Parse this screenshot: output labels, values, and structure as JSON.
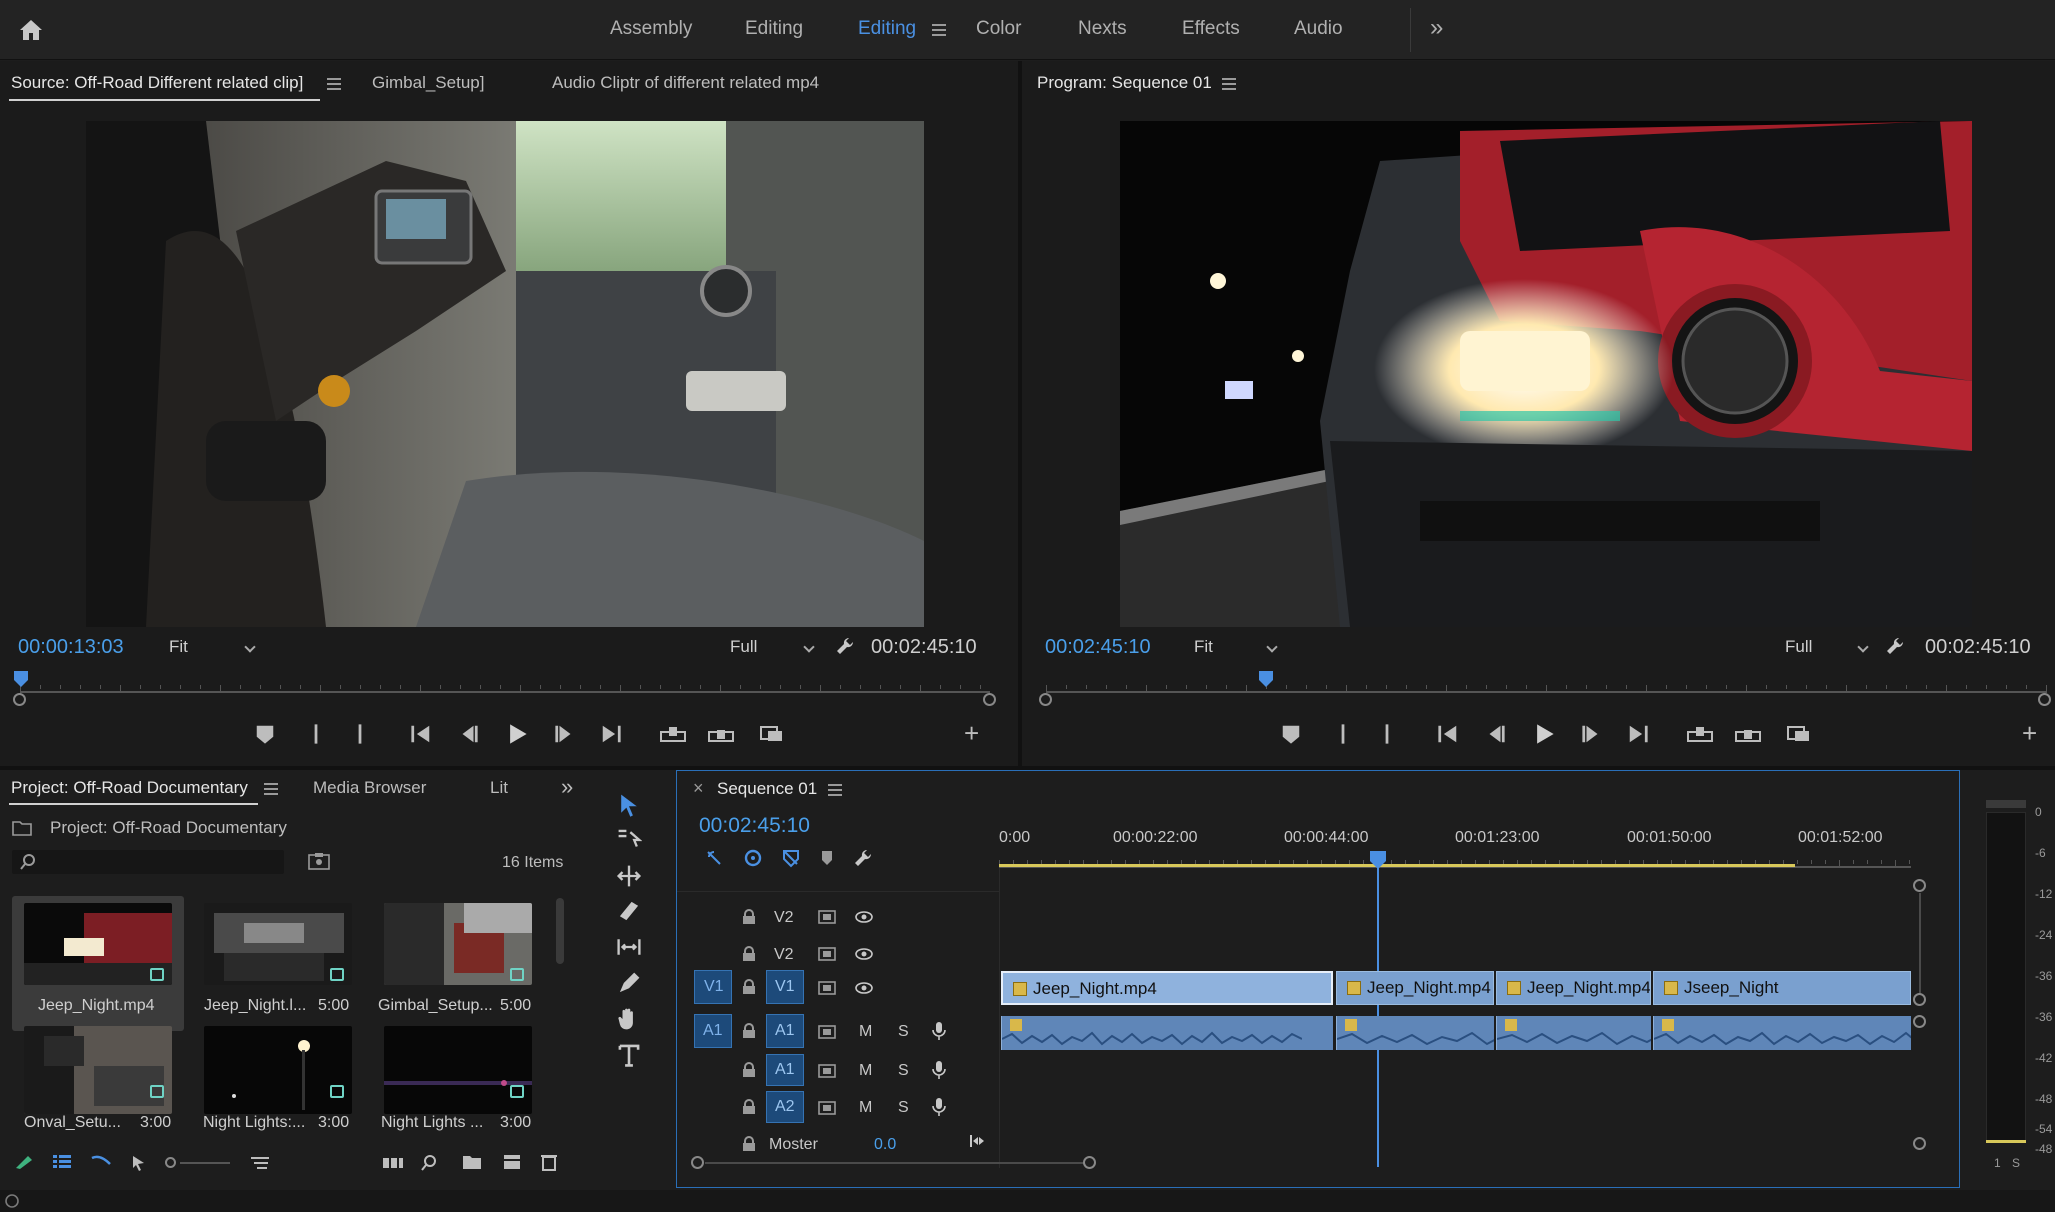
{
  "workspaces": {
    "items": [
      {
        "label": "Assembly",
        "active": false
      },
      {
        "label": "Editing",
        "active": false
      },
      {
        "label": "Editing",
        "active": true
      },
      {
        "label": "Color",
        "active": false
      },
      {
        "label": "Nexts",
        "active": false
      },
      {
        "label": "Effects",
        "active": false
      },
      {
        "label": "Audio",
        "active": false
      }
    ],
    "more": "»"
  },
  "source": {
    "tabs": [
      "Source: Off-Road Different related clip]",
      "Gimbal_Setup]",
      "Audio Cliptr of different related mp4"
    ],
    "timecode": "00:00:13:03",
    "fit": "Fit",
    "quality": "Full",
    "duration": "00:02:45:10",
    "playhead_fraction": 0.0
  },
  "program": {
    "title": "Program: Sequence 01",
    "timecode": "00:02:45:10",
    "fit": "Fit",
    "quality": "Full",
    "duration": "00:02:45:10",
    "playhead_fraction": 0.22
  },
  "project": {
    "tabs": [
      "Project: Off-Road Documentary",
      "Media Browser",
      "Lit"
    ],
    "more": "»",
    "path": "Project: Off-Road Documentary",
    "search_placeholder": "",
    "count": "16 Items",
    "items": [
      {
        "name": "Jeep_Night.mp4",
        "duration": ""
      },
      {
        "name": "Jeep_Night.l...",
        "duration": "5:00"
      },
      {
        "name": "Gimbal_Setup...",
        "duration": "5:00"
      },
      {
        "name": "Onval_Setu...",
        "duration": "3:00"
      },
      {
        "name": "Night Lights:...",
        "duration": "3:00"
      },
      {
        "name": "Night Lights ...",
        "duration": "3:00"
      }
    ]
  },
  "sequence": {
    "title": "Sequence 01",
    "close": "×",
    "timecode": "00:02:45:10",
    "ruler": [
      "0:00",
      "00:00:22:00",
      "00:00:44:00",
      "00:01:23:00",
      "00:01:50:00",
      "00:01:52:00"
    ],
    "tracks": {
      "v2a": "V2",
      "v2b": "V2",
      "v1": "V1",
      "v1_src": "V1",
      "a1": "A1",
      "a1b": "A1",
      "a2": "A2",
      "a1_src": "A1",
      "mute": "M",
      "solo": "S"
    },
    "master": {
      "label": "Moster",
      "value": "0.0"
    },
    "clips": [
      "Jeep_Night.mp4",
      "Jeep_Night.mp4",
      "Jeep_Night.mp4",
      "Jseep_Night"
    ]
  },
  "meter": {
    "labels": [
      "0",
      "-6",
      "-12",
      "-24",
      "-36",
      "-36",
      "-42",
      "-48",
      "-54",
      "-48"
    ],
    "bottom": [
      "1",
      "S"
    ]
  },
  "colors": {
    "accent": "#4a90e2",
    "clip_video": "#7aa0cf",
    "clip_audio": "#5f86b8",
    "work_area": "#d8c85a"
  }
}
